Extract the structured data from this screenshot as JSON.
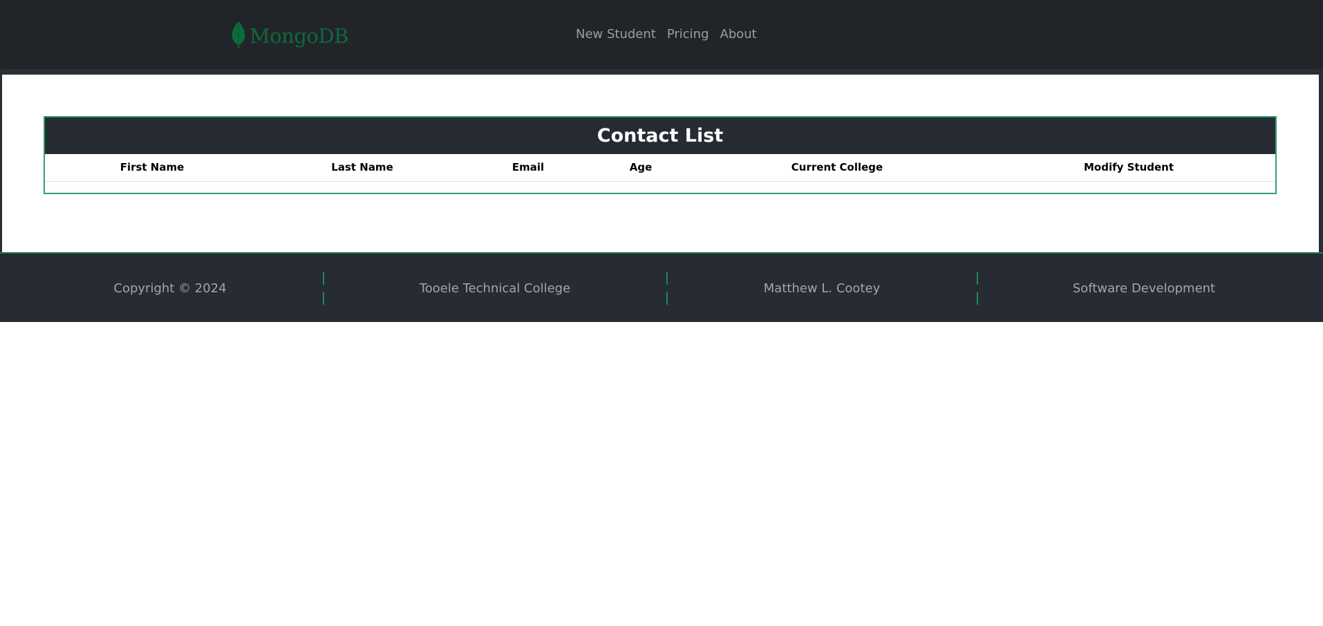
{
  "header": {
    "logo_text": "MongoDB",
    "logo_mark": ".",
    "nav": [
      {
        "label": "New Student"
      },
      {
        "label": "Pricing"
      },
      {
        "label": "About"
      }
    ]
  },
  "table": {
    "title": "Contact List",
    "columns": [
      "First Name",
      "Last Name",
      "Email",
      "Age",
      "Current College",
      "Modify Student"
    ],
    "rows": []
  },
  "footer": {
    "items": [
      {
        "label": "Copyright © 2024"
      },
      {
        "label": "Tooele Technical College"
      },
      {
        "label": "Matthew L. Cootey"
      },
      {
        "label": "Software Development"
      }
    ]
  },
  "colors": {
    "header_bg": "#212529",
    "footer_bg": "#272b33",
    "accent_green": "#2fa06d",
    "logo_green": "#11683f"
  }
}
